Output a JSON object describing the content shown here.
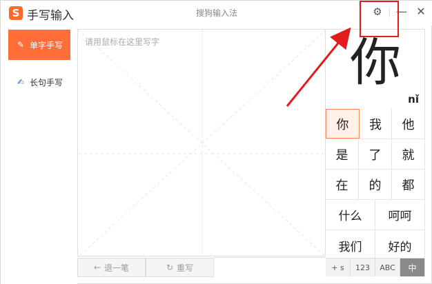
{
  "app": {
    "logo_char": "S",
    "title": "手写输入",
    "window_title": "搜狗输入法"
  },
  "window_controls": {
    "settings_icon": "gear-icon",
    "minimize_icon": "minimize-icon",
    "close_icon": "close-icon"
  },
  "sidebar": {
    "items": [
      {
        "label": "单字手写",
        "icon": "single-char-icon",
        "active": true
      },
      {
        "label": "长句手写",
        "icon": "long-sentence-icon",
        "active": false
      }
    ]
  },
  "pad": {
    "placeholder": "请用鼠标在这里写字"
  },
  "pad_buttons": {
    "undo_label": "退一笔",
    "rewrite_label": "重写"
  },
  "preview": {
    "char": "你",
    "pinyin": "nǐ"
  },
  "candidates": {
    "rows": [
      [
        "你",
        "我",
        "他"
      ],
      [
        "是",
        "了",
        "就"
      ],
      [
        "在",
        "的",
        "都"
      ],
      [
        "什么",
        "呵呵"
      ],
      [
        "我们",
        "好的"
      ]
    ]
  },
  "mode_bar": {
    "items": [
      "+ s",
      "123",
      "ABC",
      "中"
    ],
    "active_index": 3
  },
  "colors": {
    "accent": "#ff6d38",
    "annotation": "#e21c1c",
    "highlight_cell": "#fff0e8"
  }
}
